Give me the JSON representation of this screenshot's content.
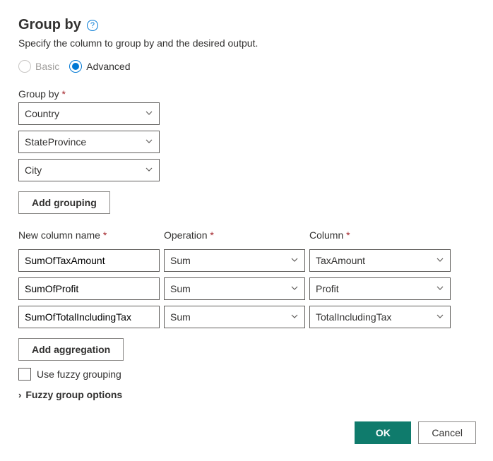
{
  "header": {
    "title": "Group by",
    "subtitle": "Specify the column to group by and the desired output."
  },
  "mode": {
    "basic_label": "Basic",
    "advanced_label": "Advanced",
    "selected": "Advanced"
  },
  "groupby": {
    "label": "Group by",
    "columns": [
      "Country",
      "StateProvince",
      "City"
    ],
    "add_label": "Add grouping"
  },
  "agg": {
    "headers": {
      "name": "New column name",
      "op": "Operation",
      "col": "Column"
    },
    "rows": [
      {
        "name": "SumOfTaxAmount",
        "op": "Sum",
        "col": "TaxAmount"
      },
      {
        "name": "SumOfProfit",
        "op": "Sum",
        "col": "Profit"
      },
      {
        "name": "SumOfTotalIncludingTax",
        "op": "Sum",
        "col": "TotalIncludingTax"
      }
    ],
    "add_label": "Add aggregation"
  },
  "fuzzy": {
    "checkbox_label": "Use fuzzy grouping",
    "expander_label": "Fuzzy group options"
  },
  "footer": {
    "ok": "OK",
    "cancel": "Cancel"
  }
}
